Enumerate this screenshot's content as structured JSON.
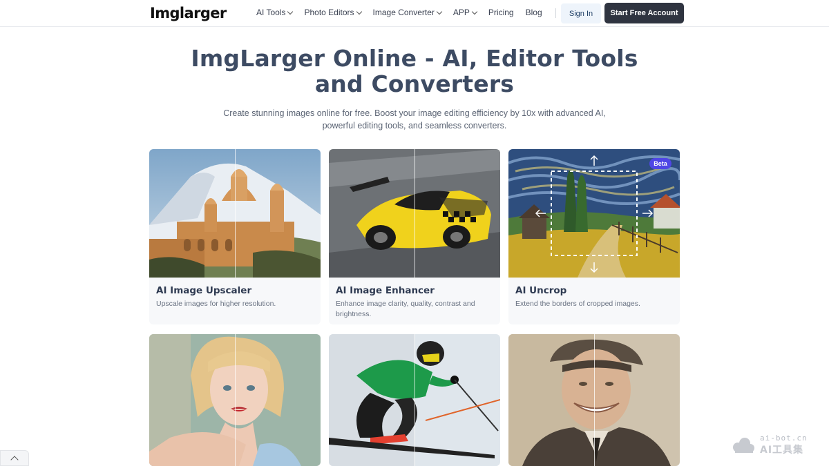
{
  "header": {
    "logo": "Imglarger",
    "nav": [
      {
        "label": "AI Tools",
        "dropdown": true
      },
      {
        "label": "Photo Editors",
        "dropdown": true
      },
      {
        "label": "Image Converter",
        "dropdown": true
      },
      {
        "label": "APP",
        "dropdown": true
      },
      {
        "label": "Pricing",
        "dropdown": false
      },
      {
        "label": "Blog",
        "dropdown": false
      }
    ],
    "sign_in": "Sign In",
    "start_free": "Start Free Account"
  },
  "hero": {
    "title_line1": "ImgLarger Online - AI, Editor Tools",
    "title_line2": "and Converters",
    "subtitle_line1": "Create stunning images online for free. Boost your image editing efficiency by 10x with advanced AI,",
    "subtitle_line2": "powerful editing tools, and seamless converters."
  },
  "cards": [
    {
      "title": "AI Image Upscaler",
      "desc": "Upscale images for higher resolution."
    },
    {
      "title": "AI Image Enhancer",
      "desc": "Enhance image clarity, quality, contrast and brightness."
    },
    {
      "title": "AI Uncrop",
      "desc": "Extend the borders of cropped images.",
      "badge": "Beta"
    },
    {
      "title": "",
      "desc": ""
    },
    {
      "title": "",
      "desc": ""
    },
    {
      "title": "",
      "desc": ""
    }
  ],
  "watermark": {
    "line1": "ai-bot.cn",
    "line2": "AI工具集"
  },
  "colors": {
    "title": "#3d4b63",
    "primary_button": "#2f3440",
    "signin_bg": "#eef4fb",
    "badge": "#4f46e5"
  }
}
